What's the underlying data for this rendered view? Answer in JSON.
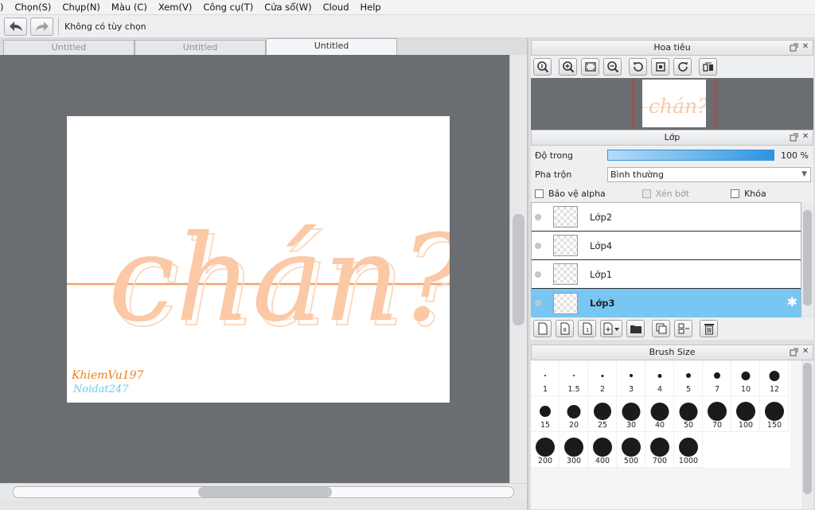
{
  "menu": [
    "Chọn(S)",
    "Chụp(N)",
    "Màu (C)",
    "Xem(V)",
    "Công cụ(T)",
    "Cửa sổ(W)",
    "Cloud",
    "Help"
  ],
  "menu_prefix": ")",
  "toolbar": {
    "tool_options": "Không có tùy chọn"
  },
  "tabs": [
    {
      "label": "Untitled",
      "active": false
    },
    {
      "label": "Untitled",
      "active": false
    },
    {
      "label": "Untitled",
      "active": true
    }
  ],
  "canvas": {
    "lettering": "chán?",
    "signature_line1": "KhiemVu197",
    "signature_line2": "Noidat247",
    "colors": {
      "lettering": "#fbc9a6",
      "guide_line": "#f4a46c",
      "sig1": "#f07f1e",
      "sig2_a": "#f3d85a",
      "sig2_b": "#6cc9ef"
    }
  },
  "navigator": {
    "title": "Hoa tiêu"
  },
  "layers_panel": {
    "title": "Lớp",
    "opacity_label": "Độ trong",
    "opacity_value": "100 %",
    "opacity": 1.0,
    "blend_label": "Pha trộn",
    "blend_value": "Bình thường",
    "checkboxes": [
      {
        "label": "Bảo vệ alpha",
        "checked": false,
        "enabled": true
      },
      {
        "label": "Xén bớt",
        "checked": false,
        "enabled": false
      },
      {
        "label": "Khóa",
        "checked": false,
        "enabled": true
      }
    ],
    "layers": [
      {
        "name": "Lớp2",
        "selected": false
      },
      {
        "name": "Lớp4",
        "selected": false
      },
      {
        "name": "Lớp1",
        "selected": false
      },
      {
        "name": "Lớp3",
        "selected": true
      }
    ]
  },
  "brush_size_panel": {
    "title": "Brush Size",
    "sizes": [
      "1",
      "1.5",
      "2",
      "3",
      "4",
      "5",
      "7",
      "10",
      "12",
      "15",
      "20",
      "25",
      "30",
      "40",
      "50",
      "70",
      "100",
      "150",
      "200",
      "300",
      "400",
      "500",
      "700",
      "1000"
    ]
  },
  "accent_color": "#78c6f2"
}
